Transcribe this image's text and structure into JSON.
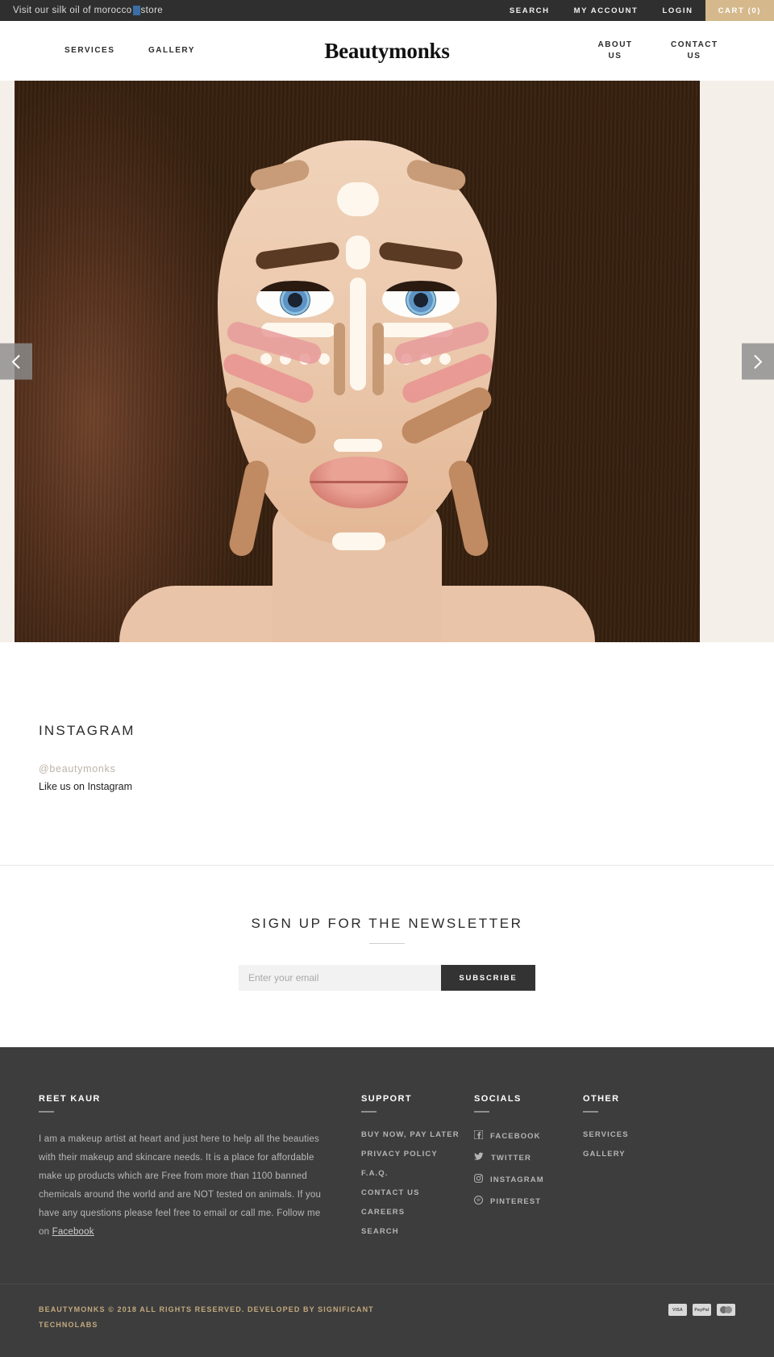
{
  "topbar": {
    "announcement_prefix": "Visit our silk oil of morocco",
    "announcement_suffix": "store",
    "links": [
      {
        "label": "SEARCH",
        "name": "search"
      },
      {
        "label": "MY ACCOUNT",
        "name": "my-account"
      },
      {
        "label": "LOGIN",
        "name": "login"
      }
    ],
    "cart_label": "CART (0)",
    "cart_accent_color": "#d5b98c",
    "background_color": "#2f2f2f"
  },
  "nav": {
    "logo": "Beautymonks",
    "left_items": [
      {
        "label": "SERVICES",
        "name": "services"
      },
      {
        "label": "GALLERY",
        "name": "gallery"
      }
    ],
    "right_items": [
      {
        "label": "ABOUT US",
        "name": "about-us"
      },
      {
        "label": "CONTACT US",
        "name": "contact-us"
      }
    ]
  },
  "hero": {
    "prev_label": "Previous slide",
    "next_label": "Next slide",
    "alt": "Woman's face with makeup contouring highlight map"
  },
  "instagram": {
    "heading": "INSTAGRAM",
    "handle": "@beautymonks",
    "subtitle": "Like us on Instagram"
  },
  "newsletter": {
    "heading": "SIGN UP FOR THE NEWSLETTER",
    "email_placeholder": "Enter your email",
    "email_value": "",
    "subscribe_label": "SUBSCRIBE"
  },
  "footer": {
    "about": {
      "heading": "REET KAUR",
      "body_before_link": "I am a makeup artist at heart and just here to help all the beauties with their makeup and skincare needs. It is a place for affordable make up products which are Free from more than 1100 banned chemicals around the world and are NOT tested on animals. If you have any questions please feel free to email or call me. Follow me on ",
      "link_label": "Facebook"
    },
    "support": {
      "heading": "SUPPORT",
      "items": [
        {
          "label": "BUY NOW, PAY LATER",
          "name": "buy-now-pay-later"
        },
        {
          "label": "PRIVACY POLICY",
          "name": "privacy-policy"
        },
        {
          "label": "F.A.Q.",
          "name": "faq"
        },
        {
          "label": "CONTACT US",
          "name": "contact-us"
        },
        {
          "label": "CAREERS",
          "name": "careers"
        },
        {
          "label": "SEARCH",
          "name": "search"
        }
      ]
    },
    "socials": {
      "heading": "SOCIALS",
      "items": [
        {
          "label": "FACEBOOK",
          "icon": "facebook-icon"
        },
        {
          "label": "TWITTER",
          "icon": "twitter-icon"
        },
        {
          "label": "INSTAGRAM",
          "icon": "instagram-icon"
        },
        {
          "label": "PINTEREST",
          "icon": "pinterest-icon"
        }
      ]
    },
    "other": {
      "heading": "OTHER",
      "items": [
        {
          "label": "SERVICES",
          "name": "services"
        },
        {
          "label": "GALLERY",
          "name": "gallery"
        }
      ]
    },
    "background_color": "#3d3d3d"
  },
  "copyright": {
    "text_before_link": "BEAUTYMONKS © 2018 ALL RIGHTS RESERVED. DEVELOPED BY ",
    "link_label": "SIGNIFICANT TECHNOLABS",
    "accent_color": "#c3a97e",
    "payment_cards": [
      {
        "label": "VISA",
        "name": "visa-card-icon"
      },
      {
        "label": "PayPal",
        "name": "paypal-card-icon"
      },
      {
        "label": "",
        "name": "mastercard-card-icon"
      }
    ]
  }
}
